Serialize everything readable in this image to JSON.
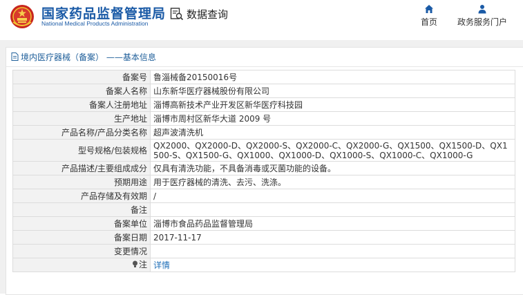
{
  "header": {
    "brand_cn": "国家药品监督管理局",
    "brand_en": "National Medical Products Administration",
    "query_label": "数据查询",
    "nav": {
      "home_label": "首页",
      "portal_label": "政务服务门户"
    }
  },
  "panel": {
    "title": "境内医疗器械（备案） ——基本信息"
  },
  "rows": [
    {
      "label": "备案号",
      "value": "鲁淄械备20150016号"
    },
    {
      "label": "备案人名称",
      "value": "山东新华医疗器械股份有限公司"
    },
    {
      "label": "备案人注册地址",
      "value": "淄博高新技术产业开发区新华医疗科技园"
    },
    {
      "label": "生产地址",
      "value": "淄博市周村区新华大道 2009 号"
    },
    {
      "label": "产品名称/产品分类名称",
      "value": "超声波清洗机"
    },
    {
      "label": "型号规格/包装规格",
      "value": "QX2000、QX2000-D、QX2000-S、QX2000-C、QX2000-G、QX1500、QX1500-D、QX1500-S、QX1500-G、QX1000、QX1000-D、QX1000-S、QX1000-C、QX1000-G"
    },
    {
      "label": "产品描述/主要组成成分",
      "value": "仅具有清洗功能，不具备消毒或灭菌功能的设备。"
    },
    {
      "label": "预期用途",
      "value": "用于医疗器械的清洗、去污、洗涤。"
    },
    {
      "label": "产品存储及有效期",
      "value": "/"
    },
    {
      "label": "备注",
      "value": ""
    },
    {
      "label": "备案单位",
      "value": "淄博市食品药品监督管理局"
    },
    {
      "label": "备案日期",
      "value": "2017-11-17"
    },
    {
      "label": "变更情况",
      "value": ""
    },
    {
      "label": "注",
      "value": "详情"
    }
  ],
  "colors": {
    "brand_blue": "#1a5aa6",
    "link_blue": "#1f6fb8",
    "label_bg": "#f2f2f2",
    "band_bg": "#f0f0f0"
  },
  "icons": {
    "emblem": "national-emblem-icon",
    "query": "data-query-icon",
    "home": "home-icon",
    "portal": "user-icon",
    "panel": "document-icon",
    "note": "lightbulb-icon"
  }
}
